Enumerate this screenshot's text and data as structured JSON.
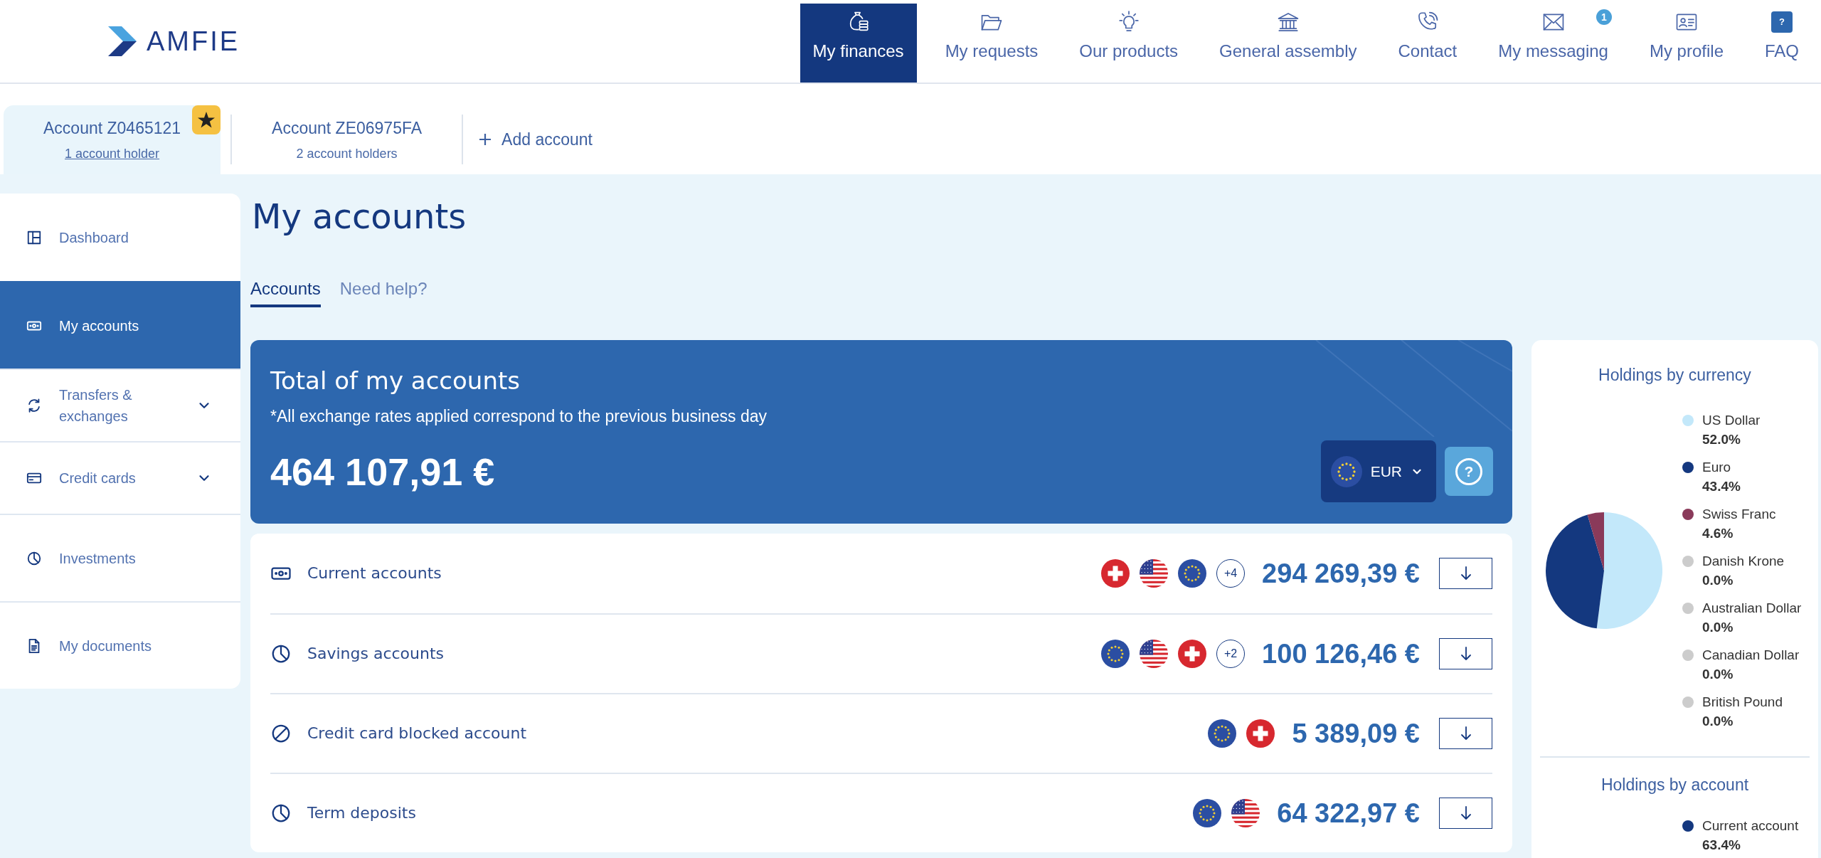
{
  "header": {
    "logo": "AMFIE",
    "nav": [
      {
        "kind": "finances",
        "label": "My finances",
        "selected": true
      },
      {
        "kind": "requests",
        "label": "My requests",
        "selected": false
      },
      {
        "kind": "products",
        "label": "Our products",
        "selected": false
      },
      {
        "kind": "assembly",
        "label": "General assembly",
        "selected": false
      },
      {
        "kind": "contact",
        "label": "Contact",
        "selected": false
      },
      {
        "kind": "messaging",
        "label": "My messaging",
        "selected": false,
        "badge": "1"
      },
      {
        "kind": "profile",
        "label": "My profile",
        "selected": false
      },
      {
        "kind": "faq",
        "label": "FAQ",
        "selected": false,
        "icon_text": "?"
      }
    ]
  },
  "account_tabs": {
    "tabs": [
      {
        "label": "Account Z0465121",
        "holders": "1 account holder",
        "selected": true,
        "favorite": true
      },
      {
        "label": "Account ZE06975FA",
        "holders": "2 account holders",
        "selected": false,
        "favorite": false
      }
    ],
    "add_button": "Add account"
  },
  "sidebar": {
    "items": [
      {
        "kind": "dashboard",
        "label": "Dashboard",
        "selected": false
      },
      {
        "kind": "accounts",
        "label": "My accounts",
        "selected": true
      },
      {
        "kind": "transfers",
        "label": "Transfers & exchanges",
        "selected": false,
        "expanded": false
      },
      {
        "kind": "cards",
        "label": "Credit cards",
        "selected": false,
        "expanded": false
      },
      {
        "kind": "investments",
        "label": "Investments",
        "selected": false
      },
      {
        "kind": "documents",
        "label": "My documents",
        "selected": false
      }
    ]
  },
  "page": {
    "title": "My accounts",
    "tabs": [
      {
        "label": "Accounts",
        "selected": true
      },
      {
        "label": "Need help?",
        "selected": false
      }
    ]
  },
  "total": {
    "title": "Total of my accounts",
    "note": "*All exchange rates applied correspond to the previous business day",
    "amount": "464 107,91 €",
    "currency": {
      "kind": "eu",
      "code": "EUR"
    },
    "help_label": "?"
  },
  "accounts": [
    {
      "kind": "cash",
      "label": "Current accounts",
      "currencies": [
        {
          "kind": "ch"
        },
        {
          "kind": "us"
        },
        {
          "kind": "eu"
        }
      ],
      "more": "+4",
      "amount": "294 269,39 €"
    },
    {
      "kind": "pie",
      "label": "Savings accounts",
      "currencies": [
        {
          "kind": "eu"
        },
        {
          "kind": "us"
        },
        {
          "kind": "ch"
        }
      ],
      "more": "+2",
      "amount": "100 126,46 €"
    },
    {
      "kind": "blocked",
      "label": "Credit card blocked account",
      "currencies": [
        {
          "kind": "eu"
        },
        {
          "kind": "ch"
        }
      ],
      "amount": "5 389,09 €"
    },
    {
      "kind": "pie",
      "label": "Term deposits",
      "currencies": [
        {
          "kind": "eu"
        },
        {
          "kind": "us"
        }
      ],
      "amount": "64 322,97 €"
    }
  ],
  "holdings_by_currency": {
    "chart_data": {
      "type": "pie",
      "title": "Holdings by currency",
      "categories": [
        "US Dollar",
        "Euro",
        "Swiss Franc",
        "Danish Krone",
        "Australian Dollar",
        "Canadian Dollar",
        "British Pound"
      ],
      "values": [
        52.0,
        43.4,
        4.6,
        0.0,
        0.0,
        0.0,
        0.0
      ],
      "colors": [
        "#c3e8fa",
        "#14387f",
        "#8a3a5a",
        "#cccccc",
        "#cccccc",
        "#cccccc",
        "#cccccc"
      ],
      "value_labels": [
        "52.0%",
        "43.4%",
        "4.6%",
        "0.0%",
        "0.0%",
        "0.0%",
        "0.0%"
      ],
      "legend": "right"
    }
  },
  "holdings_by_account": {
    "title": "Holdings by account",
    "legend": [
      {
        "label": "Current account",
        "value": "63.4%",
        "color": "#14387f"
      }
    ]
  }
}
